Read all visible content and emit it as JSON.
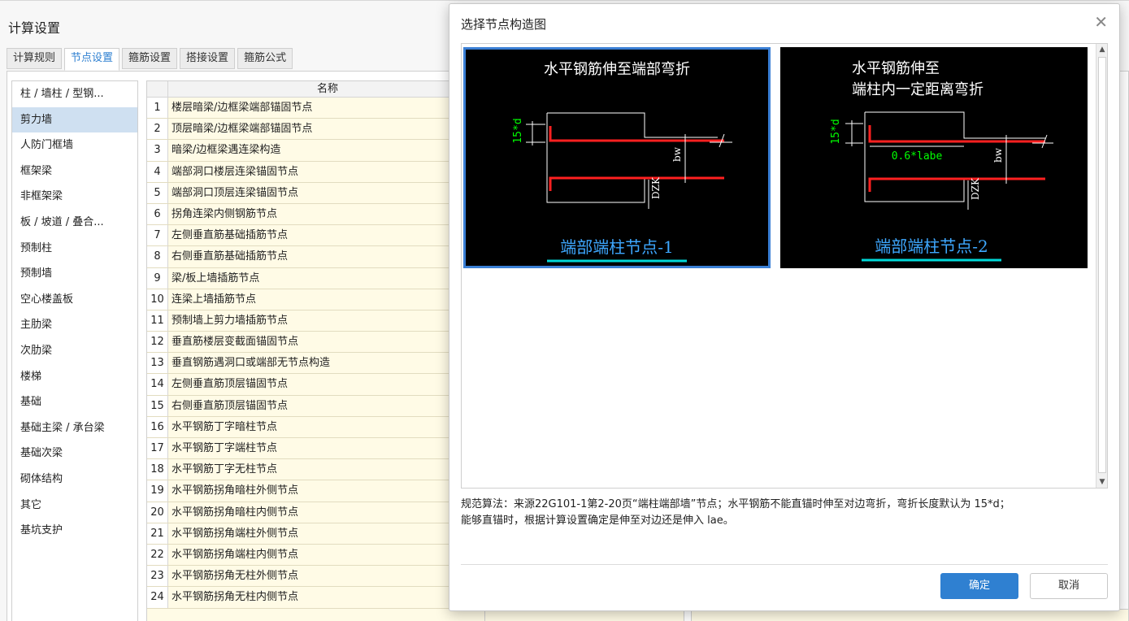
{
  "background": {
    "title": "计算设置",
    "tabs": [
      "计算规则",
      "节点设置",
      "箍筋设置",
      "搭接设置",
      "箍筋公式"
    ],
    "active_tab": "节点设置",
    "categories": [
      "柱 / 墙柱 / 型钢...",
      "剪力墙",
      "人防门框墙",
      "框架梁",
      "非框架梁",
      "板 / 坡道 / 叠合...",
      "预制柱",
      "预制墙",
      "空心楼盖板",
      "主肋梁",
      "次肋梁",
      "楼梯",
      "基础",
      "基础主梁 / 承台梁",
      "基础次梁",
      "砌体结构",
      "其它",
      "基坑支护"
    ],
    "selected_category": "剪力墙",
    "table_header": "名称",
    "rows": [
      "楼层暗梁/边框梁端部锚固节点",
      "顶层暗梁/边框梁端部锚固节点",
      "暗梁/边框梁遇连梁构造",
      "端部洞口楼层连梁锚固节点",
      "端部洞口顶层连梁锚固节点",
      "拐角连梁内侧钢筋节点",
      "左侧垂直筋基础插筋节点",
      "右侧垂直筋基础插筋节点",
      "梁/板上墙插筋节点",
      "连梁上墙插筋节点",
      "预制墙上剪力墙插筋节点",
      "垂直筋楼层变截面锚固节点",
      "垂直钢筋遇洞口或端部无节点构造",
      "左侧垂直筋顶层锚固节点",
      "右侧垂直筋顶层锚固节点",
      "水平钢筋丁字暗柱节点",
      "水平钢筋丁字端柱节点",
      "水平钢筋丁字无柱节点",
      "水平钢筋拐角暗柱外侧节点",
      "水平钢筋拐角暗柱内侧节点",
      "水平钢筋拐角端柱外侧节点",
      "水平钢筋拐角端柱内侧节点",
      "水平钢筋拐角无柱外侧节点",
      "水平钢筋拐角无柱内侧节点"
    ]
  },
  "dialog": {
    "title": "选择节点构造图",
    "close_icon": "close-icon",
    "cards": [
      {
        "heading_lines": [
          "水平钢筋伸至端部弯折"
        ],
        "caption": "端部端柱节点-1",
        "dim_label": "15*d",
        "bw_label": "bw",
        "col_label": "DZK",
        "selected": true
      },
      {
        "heading_lines": [
          "水平钢筋伸至",
          "端柱内一定距离弯折"
        ],
        "caption": "端部端柱节点-2",
        "dim_label": "15*d",
        "inner_label": "0.6*labe",
        "bw_label": "bw",
        "col_label": "DZK",
        "selected": false
      }
    ],
    "description_line1": "规范算法：来源22G101-1第2-20页“端柱端部墙”节点；水平钢筋不能直锚时伸至对边弯折，弯折长度默认为 15*d；",
    "description_line2": "能够直锚时，根据计算设置确定是伸至对边还是伸入 lae。",
    "ok_label": "确定",
    "cancel_label": "取消"
  },
  "colors": {
    "accent": "#2f80d1",
    "selected_row": "#cfe0f1",
    "table_bg": "#fffbe6",
    "rebar": "#ff2020",
    "dim_text": "#00ff00",
    "caption_text": "#3ea8ff",
    "caption_underline": "#00d8d8"
  }
}
